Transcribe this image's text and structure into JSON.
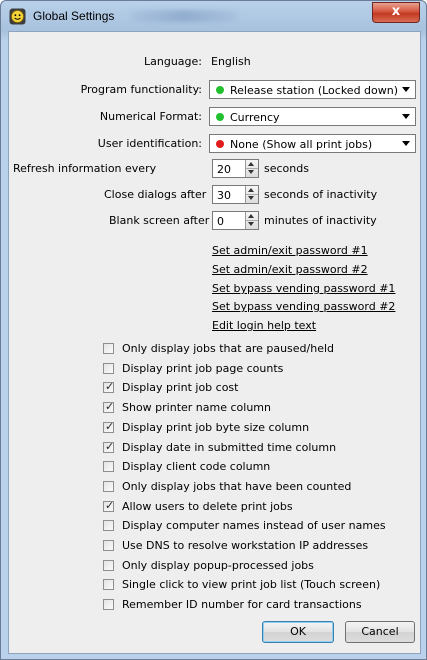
{
  "window": {
    "title": "Global Settings",
    "close_label": "x"
  },
  "settings": {
    "language_label": "Language:",
    "language_value": "English",
    "program_functionality": {
      "label": "Program functionality:",
      "value": "Release station (Locked down)",
      "status_color": "#22c02e"
    },
    "numerical_format": {
      "label": "Numerical Format:",
      "value": "Currency",
      "status_color": "#22c02e"
    },
    "user_identification": {
      "label": "User identification:",
      "value": "None (Show all print jobs)",
      "status_color": "#e21b1b"
    },
    "refresh": {
      "label": "Refresh information every",
      "value": "20",
      "unit": "seconds"
    },
    "close_dialogs": {
      "label": "Close dialogs after",
      "value": "30",
      "unit": "seconds of inactivity"
    },
    "blank_screen": {
      "label": "Blank screen after",
      "value": "0",
      "unit": "minutes of inactivity"
    }
  },
  "links": [
    "Set admin/exit password #1",
    "Set admin/exit password #2",
    "Set bypass vending password #1",
    "Set bypass vending password #2",
    "Edit login help text"
  ],
  "checkboxes": [
    {
      "label": "Only display jobs that are paused/held",
      "checked": false
    },
    {
      "label": "Display print job page counts",
      "checked": false
    },
    {
      "label": "Display print job cost",
      "checked": true
    },
    {
      "label": "Show printer name column",
      "checked": true
    },
    {
      "label": "Display print job byte size column",
      "checked": true
    },
    {
      "label": "Display date in submitted time column",
      "checked": true
    },
    {
      "label": "Display client code column",
      "checked": false
    },
    {
      "label": "Only display jobs that have been counted",
      "checked": false
    },
    {
      "label": "Allow users to delete print jobs",
      "checked": true
    },
    {
      "label": "Display computer names instead of user names",
      "checked": false
    },
    {
      "label": "Use DNS to resolve workstation IP addresses",
      "checked": false
    },
    {
      "label": "Only display popup-processed jobs",
      "checked": false
    },
    {
      "label": "Single click to view print job list (Touch screen)",
      "checked": false
    },
    {
      "label": "Remember ID number for card transactions",
      "checked": false
    }
  ],
  "buttons": {
    "ok": "OK",
    "cancel": "Cancel"
  }
}
